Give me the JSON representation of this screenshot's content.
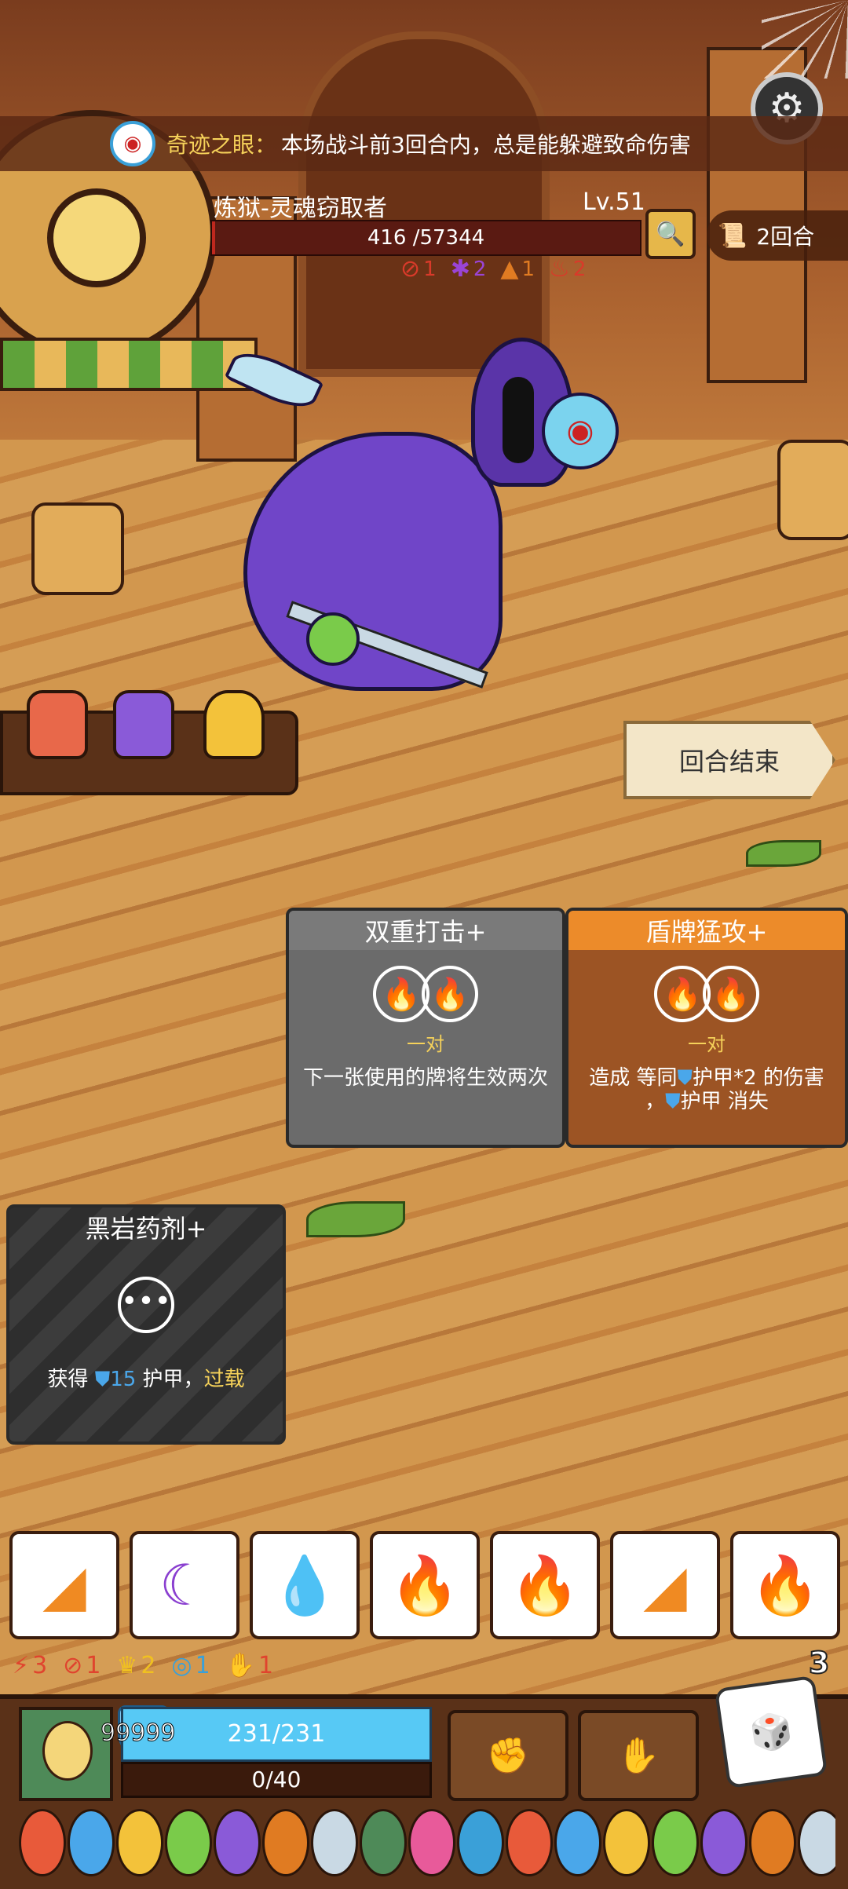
{
  "banner": {
    "icon": "eye-icon",
    "name": "奇迹之眼：",
    "text": "本场战斗前3回合内，总是能躲避致命伤害"
  },
  "boss": {
    "name": "炼狱-灵魂窃取者",
    "level": "Lv.51",
    "hp_text": "416 /57344",
    "hp_current": 416,
    "hp_max": 57344,
    "intents": [
      {
        "icon": "attack-icon",
        "value": "1",
        "color": "#d93a2a"
      },
      {
        "icon": "curse-icon",
        "value": "2",
        "color": "#9a44d6"
      },
      {
        "icon": "flame-buff-icon",
        "value": "1",
        "color": "#e07b22"
      },
      {
        "icon": "rage-icon",
        "value": "2",
        "color": "#d93a2a"
      }
    ]
  },
  "round": {
    "label": "2回合"
  },
  "end_turn": {
    "label": "回合结束"
  },
  "cards": [
    {
      "title": "双重打击+",
      "requirement": "一对",
      "desc": "下一张使用的牌将生效两次",
      "theme": "gray"
    },
    {
      "title": "盾牌猛攻+",
      "requirement": "一对",
      "desc_parts": [
        "造成 等同",
        "护甲*2 的伤害",
        "，",
        "护甲 消失"
      ],
      "theme": "orange"
    },
    {
      "title": "黑岩药剂+",
      "desc_parts": [
        "获得 ",
        "15",
        " 护甲，",
        "过载"
      ],
      "theme": "dark"
    }
  ],
  "dice": [
    {
      "face": "earth",
      "color": "#f08a22"
    },
    {
      "face": "moon",
      "color": "#8a3fd0"
    },
    {
      "face": "water",
      "color": "#2a7ad8"
    },
    {
      "face": "fire",
      "color": "#ea3320"
    },
    {
      "face": "fire",
      "color": "#ea3320"
    },
    {
      "face": "earth",
      "color": "#f08a22"
    },
    {
      "face": "fire",
      "color": "#ea3320"
    }
  ],
  "status_stats": [
    {
      "icon": "fire-strike-icon",
      "value": "3",
      "color": "#e0442e"
    },
    {
      "icon": "no-attack-icon",
      "value": "1",
      "color": "#e0442e"
    },
    {
      "icon": "crown-icon",
      "value": "2",
      "color": "#f0c020"
    },
    {
      "icon": "swirl-icon",
      "value": "1",
      "color": "#3aa0d8"
    },
    {
      "icon": "hand-icon",
      "value": "1",
      "color": "#e0442e"
    }
  ],
  "dice_left": "3",
  "player": {
    "armor": "99999",
    "hp_text": "231/231",
    "mp_text": "0/40"
  },
  "colors": {
    "accent": "#f6d25a",
    "hp_blue": "#57c9f5",
    "boss_red": "#c0281e"
  }
}
